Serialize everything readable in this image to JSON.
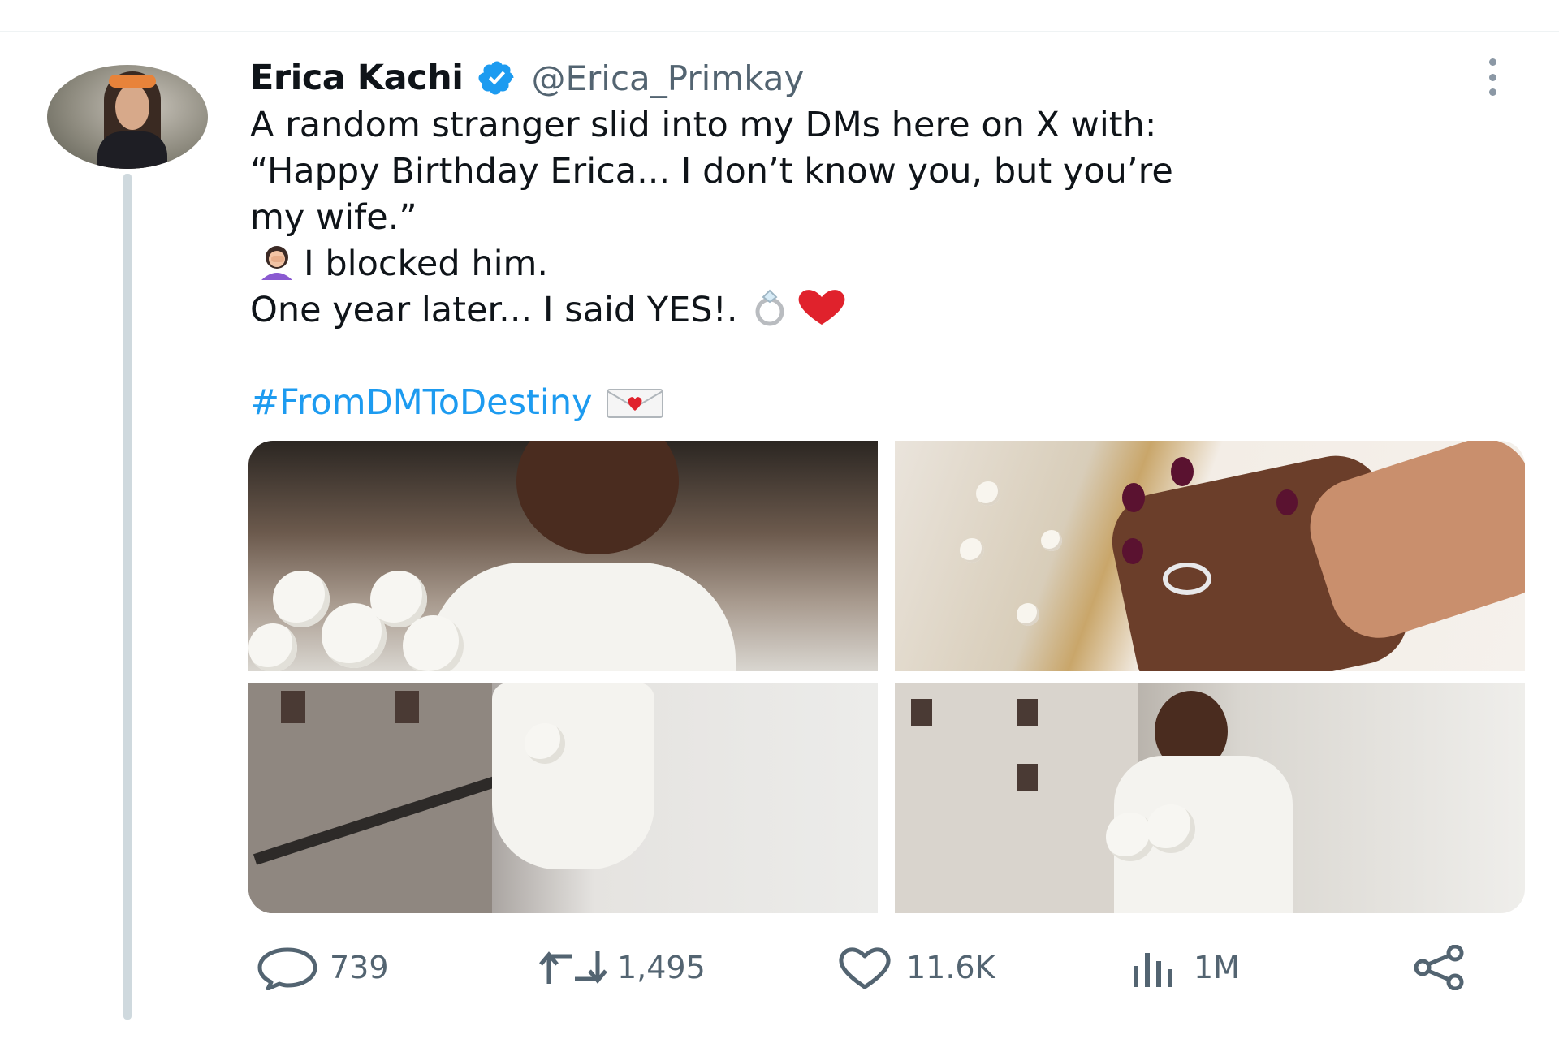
{
  "tweet": {
    "display_name": "Erica Kachi",
    "handle": "@Erica_Primkay",
    "body_lines": [
      "A random stranger slid into my DMs here on X with:",
      "“Happy Birthday Erica... I don’t know you, but you’re",
      "my wife.”",
      "I blocked him.",
      "One year later... I said YES!."
    ],
    "hashtag": "#FromDMToDestiny",
    "media_count": 4
  },
  "actions": {
    "replies": "739",
    "retweets": "1,495",
    "likes": "11.6K",
    "views": "1M"
  },
  "icons": {
    "verified": "verified-badge-icon",
    "more": "more-options-icon",
    "facepalm": "facepalm-emoji-icon",
    "ring": "ring-emoji-icon",
    "heart": "red-heart-emoji-icon",
    "envelope": "love-letter-emoji-icon",
    "reply": "reply-icon",
    "retweet": "retweet-icon",
    "like": "like-heart-icon",
    "views": "views-chart-icon",
    "share": "share-icon"
  },
  "colors": {
    "link": "#1d9bf0",
    "secondary_text": "#536471",
    "verified": "#1d9bf0",
    "thread_line": "#cfd9de"
  }
}
